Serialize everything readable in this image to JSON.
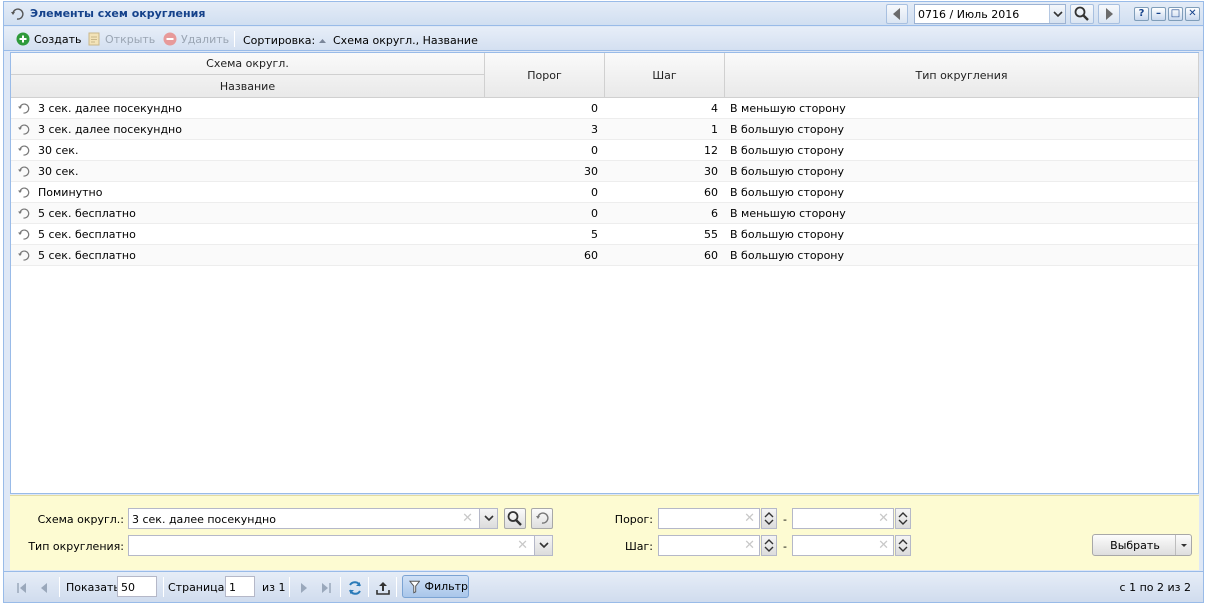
{
  "window": {
    "title": "Элементы схем округления",
    "period_value": "0716 / Июль 2016",
    "tools": [
      "?",
      "–",
      "□",
      "✕"
    ]
  },
  "toolbar": {
    "create_label": "Создать",
    "open_label": "Открыть",
    "delete_label": "Удалить",
    "sort_label": "Сортировка:",
    "sort_value": "Схема округл., Название"
  },
  "grid": {
    "group_header": "Схема округл.",
    "columns": {
      "name": "Название",
      "threshold": "Порог",
      "step": "Шаг",
      "rounding_type": "Тип округления"
    },
    "rows": [
      {
        "name": "3 сек. далее посекундно",
        "threshold": "0",
        "step": "4",
        "type": "В меньшую сторону"
      },
      {
        "name": "3 сек. далее посекундно",
        "threshold": "3",
        "step": "1",
        "type": "В большую сторону"
      },
      {
        "name": "30 сек.",
        "threshold": "0",
        "step": "12",
        "type": "В большую сторону"
      },
      {
        "name": "30 сек.",
        "threshold": "30",
        "step": "30",
        "type": "В большую сторону"
      },
      {
        "name": "Поминутно",
        "threshold": "0",
        "step": "60",
        "type": "В большую сторону"
      },
      {
        "name": "5 сек. бесплатно",
        "threshold": "0",
        "step": "6",
        "type": "В меньшую сторону"
      },
      {
        "name": "5 сек. бесплатно",
        "threshold": "5",
        "step": "55",
        "type": "В большую сторону"
      },
      {
        "name": "5 сек. бесплатно",
        "threshold": "60",
        "step": "60",
        "type": "В большую сторону"
      }
    ]
  },
  "filter": {
    "scheme_label": "Схема округл.:",
    "scheme_value": "3 сек. далее посекундно",
    "rounding_type_label": "Тип округления:",
    "rounding_type_value": "",
    "threshold_label": "Порог:",
    "step_label": "Шаг:",
    "range_dash": "-",
    "select_label": "Выбрать"
  },
  "paging": {
    "show_label": "Показать",
    "page_size": "50",
    "page_label": "Страница",
    "page_value": "1",
    "of_label": "из 1",
    "filter_label": "Фильтр",
    "info": "с 1 по 2 из 2"
  },
  "colors": {
    "accent": "#15428b",
    "border": "#99bbe8",
    "filter_bg": "#fdfbd2",
    "create_green": "#2f9a3b",
    "delete_red": "#e06060"
  }
}
